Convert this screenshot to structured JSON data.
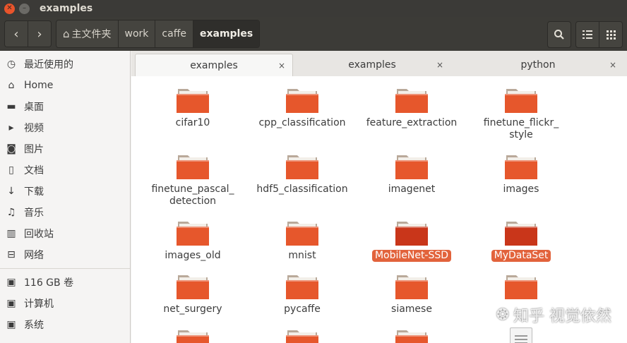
{
  "window": {
    "title": "examples"
  },
  "toolbar": {
    "breadcrumbs": [
      "主文件夹",
      "work",
      "caffe",
      "examples"
    ]
  },
  "sidebar": {
    "items": [
      {
        "label": "最近使用的",
        "icon": "clock-icon"
      },
      {
        "label": "Home",
        "icon": "home-icon"
      },
      {
        "label": "桌面",
        "icon": "folder-icon"
      },
      {
        "label": "视频",
        "icon": "video-icon"
      },
      {
        "label": "图片",
        "icon": "camera-icon"
      },
      {
        "label": "文档",
        "icon": "document-icon"
      },
      {
        "label": "下载",
        "icon": "download-icon"
      },
      {
        "label": "音乐",
        "icon": "music-icon"
      },
      {
        "label": "回收站",
        "icon": "trash-icon"
      },
      {
        "label": "网络",
        "icon": "network-icon"
      }
    ],
    "devices": [
      {
        "label": "116 GB 卷",
        "icon": "drive-icon"
      },
      {
        "label": "计算机",
        "icon": "computer-icon"
      },
      {
        "label": "系统",
        "icon": "system-drive-icon"
      }
    ]
  },
  "tabs": [
    {
      "label": "examples"
    },
    {
      "label": "examples"
    },
    {
      "label": "python"
    }
  ],
  "files": [
    {
      "name": "cifar10",
      "type": "folder"
    },
    {
      "name": "cpp_classification",
      "type": "folder"
    },
    {
      "name": "feature_extraction",
      "type": "folder"
    },
    {
      "name": "finetune_flickr_\nstyle",
      "type": "folder"
    },
    {
      "name": "finetune_pascal_\ndetection",
      "type": "folder"
    },
    {
      "name": "hdf5_classification",
      "type": "folder"
    },
    {
      "name": "imagenet",
      "type": "folder"
    },
    {
      "name": "images",
      "type": "folder"
    },
    {
      "name": "images_old",
      "type": "folder"
    },
    {
      "name": "mnist",
      "type": "folder"
    },
    {
      "name": "MobileNet-SSD",
      "type": "folder",
      "selected": true
    },
    {
      "name": "MyDataSet",
      "type": "folder",
      "selected": true
    },
    {
      "name": "net_surgery",
      "type": "folder"
    },
    {
      "name": "pycaffe",
      "type": "folder"
    },
    {
      "name": "siamese",
      "type": "folder"
    },
    {
      "name": "",
      "type": "folder"
    },
    {
      "name": "",
      "type": "folder"
    },
    {
      "name": "",
      "type": "folder"
    },
    {
      "name": "",
      "type": "folder"
    },
    {
      "name": "",
      "type": "document"
    }
  ],
  "watermark": "知乎 视觉依然",
  "colors": {
    "folder": "#e6572c",
    "folder_selected": "#c9361a",
    "selection": "#e2633c",
    "titlebar": "#3b3a37"
  }
}
